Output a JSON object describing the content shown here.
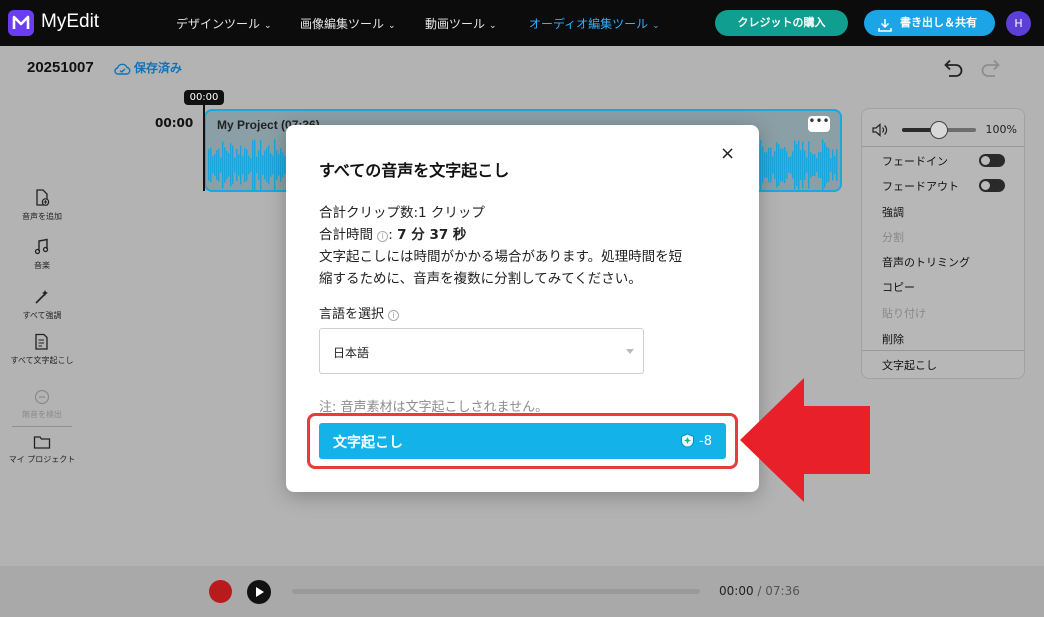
{
  "app": {
    "name": "MyEdit",
    "brand_color": "#6a3df0"
  },
  "nav": [
    {
      "label": "デザインツール",
      "active": false
    },
    {
      "label": "画像編集ツール",
      "active": false
    },
    {
      "label": "動画ツール",
      "active": false
    },
    {
      "label": "オーディオ編集ツール",
      "active": true
    }
  ],
  "header": {
    "credit_label": "クレジットの購入",
    "export_label": "書き出し＆共有",
    "avatar_initial": "H"
  },
  "project": {
    "name": "20251007",
    "save_status": "保存済み"
  },
  "timeline": {
    "playhead_time": "00:00",
    "start_label": "00:00",
    "clip_title": "My Project  (07:36)",
    "clip_menu": "•••"
  },
  "sidebar": [
    {
      "label": "音声を追加",
      "icon": "add-audio-icon",
      "enabled": true
    },
    {
      "label": "音楽",
      "icon": "music-icon",
      "enabled": true
    },
    {
      "label": "すべて強調",
      "icon": "magic-wand-icon",
      "enabled": true
    },
    {
      "label": "すべて文字起こし",
      "icon": "transcribe-all-icon",
      "enabled": true
    },
    {
      "label": "無音を検出",
      "icon": "silence-detect-icon",
      "enabled": false
    },
    {
      "label": "マイ プロジェクト",
      "icon": "folder-icon",
      "enabled": true
    }
  ],
  "right_panel": {
    "volume_percent": "100%",
    "volume_level": 0.5,
    "items": [
      {
        "label": "フェードイン",
        "toggle": true,
        "enabled": true
      },
      {
        "label": "フェードアウト",
        "toggle": true,
        "enabled": true
      },
      {
        "label": "強調",
        "enabled": true
      },
      {
        "label": "分割",
        "enabled": false
      },
      {
        "label": "音声のトリミング",
        "enabled": true
      },
      {
        "label": "コピー",
        "enabled": true
      },
      {
        "label": "貼り付け",
        "enabled": false
      },
      {
        "label": "削除",
        "enabled": true
      },
      {
        "label": "文字起こし",
        "enabled": true
      }
    ]
  },
  "player": {
    "current_time": "00:00",
    "separator": " / ",
    "total_time": "07:36",
    "progress": 0
  },
  "modal": {
    "title": "すべての音声を文字起こし",
    "clip_count": "合計クリップ数:1 クリップ",
    "duration_label": "合計時間",
    "duration_sep": ":",
    "duration_value": "7 分 37 秒",
    "notice_line1": "文字起こしには時間がかかる場合があります。処理時間を短",
    "notice_line2": "縮するために、音声を複数に分割してみてください。",
    "language_label": "言語を選択",
    "language_value": "日本語",
    "note": "注: 音声素材は文字起こしされません。",
    "button_label": "文字起こし",
    "button_cost": "-8",
    "close_label": "×"
  },
  "colors": {
    "accent": "#13b3ea",
    "highlight_border": "#e83b3b",
    "arrow": "#e8202a"
  }
}
